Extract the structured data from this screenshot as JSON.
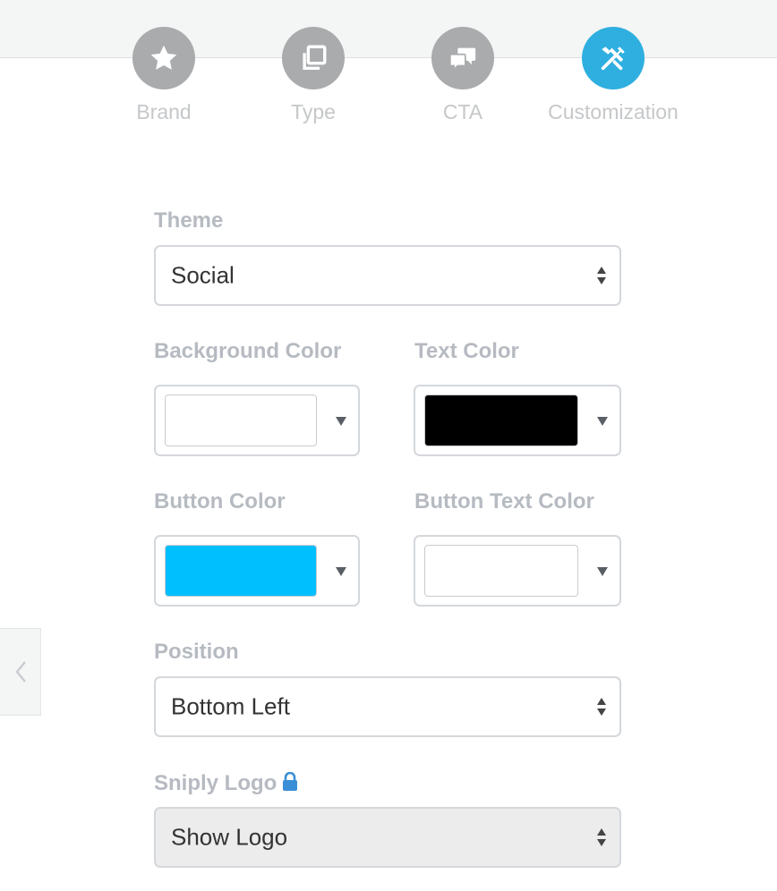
{
  "steps": [
    {
      "label": "Brand",
      "icon": "star-icon",
      "active": false
    },
    {
      "label": "Type",
      "icon": "copy-icon",
      "active": false
    },
    {
      "label": "CTA",
      "icon": "chat-bubbles-icon",
      "active": false
    },
    {
      "label": "Customization",
      "icon": "tools-icon",
      "active": true
    }
  ],
  "form": {
    "theme": {
      "label": "Theme",
      "value": "Social"
    },
    "background_color": {
      "label": "Background Color",
      "value": "#ffffff"
    },
    "text_color": {
      "label": "Text Color",
      "value": "#000000"
    },
    "button_color": {
      "label": "Button Color",
      "value": "#00bfff"
    },
    "button_text_color": {
      "label": "Button Text Color",
      "value": "#ffffff"
    },
    "position": {
      "label": "Position",
      "value": "Bottom Left"
    },
    "logo": {
      "label": "Sniply Logo",
      "value": "Show Logo",
      "locked": true
    }
  },
  "colors": {
    "accent": "#2eafe0",
    "step_inactive": "#a9abad",
    "lock": "#3b8fd6"
  }
}
